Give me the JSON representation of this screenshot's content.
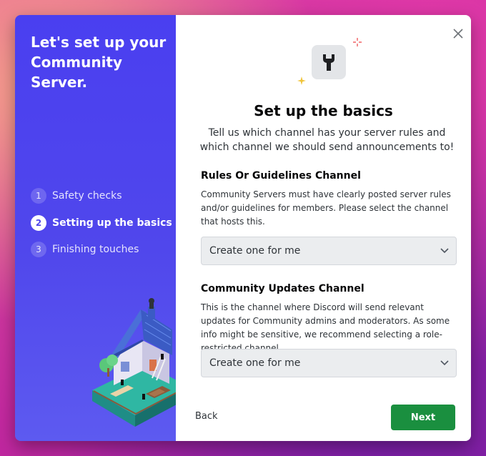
{
  "sidebar": {
    "title": "Let's set up your Community Server.",
    "steps": [
      {
        "number": "1",
        "label": "Safety checks",
        "active": false
      },
      {
        "number": "2",
        "label": "Setting up the basics",
        "active": true
      },
      {
        "number": "3",
        "label": "Finishing touches",
        "active": false
      }
    ],
    "illustration_icon": "isometric-house-illustration"
  },
  "main": {
    "close_icon": "close-icon",
    "header_icon": "wrench-icon",
    "title": "Set up the basics",
    "subtitle": "Tell us which channel has your server rules and which channel we should send announcements to!",
    "rules_section": {
      "title": "Rules Or Guidelines Channel",
      "description": "Community Servers must have clearly posted server rules and/or guidelines for members. Please select the channel that hosts this.",
      "select_value": "Create one for me"
    },
    "updates_section": {
      "title": "Community Updates Channel",
      "description": "This is the channel where Discord will send relevant updates for Community admins and moderators. As some info might be sensitive, we recommend selecting a role-restricted channel.",
      "select_value": "Create one for me"
    }
  },
  "footer": {
    "back_label": "Back",
    "next_label": "Next"
  },
  "colors": {
    "sidebar": "#5047ec",
    "next_button": "#1a8f3f",
    "select_bg": "#ebedef"
  }
}
